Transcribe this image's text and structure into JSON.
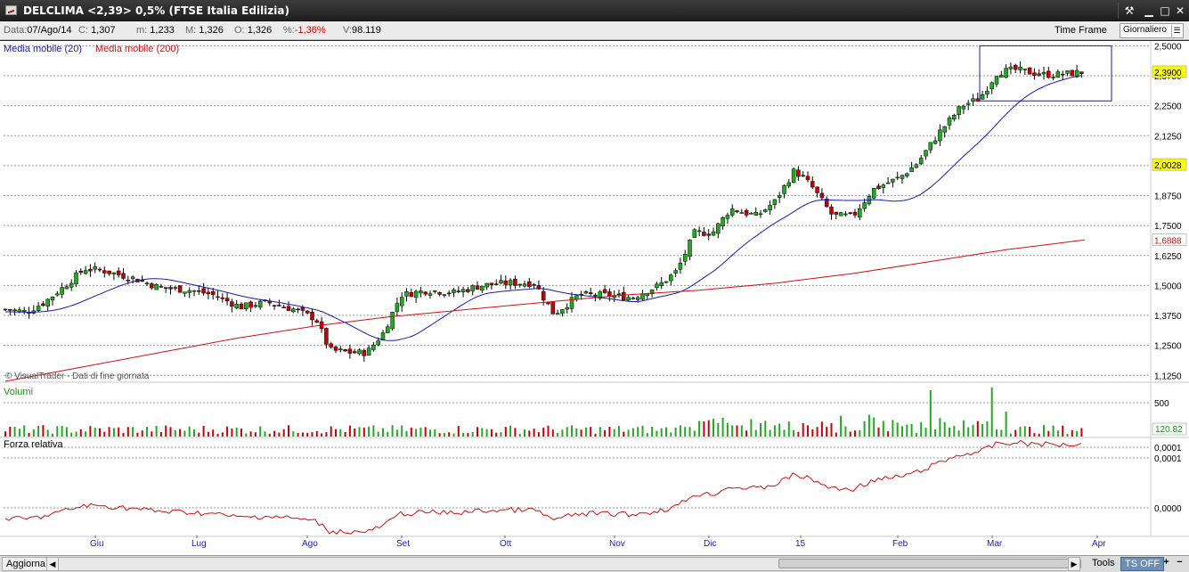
{
  "window": {
    "title": "DELCLIMA <2,39> 0,5%  (FTSE Italia Edilizia)",
    "buttons": {
      "tools": "⚒",
      "minimize": "▁",
      "maximize": "□",
      "close": "✕"
    }
  },
  "infobar": {
    "date_label": "Data:",
    "date_value": "07/Ago/14",
    "close_label": "C:",
    "close_value": "1,307",
    "min_label": "m:",
    "min_value": "1,233",
    "max_label": "M:",
    "max_value": "1,326",
    "open_label": "O:",
    "open_value": "1,326",
    "pct_label": "%:",
    "pct_value": "-1,36%",
    "vol_label": "V:",
    "vol_value": "98.119",
    "timeframe_label": "Time Frame",
    "timeframe_value": "Giornaliero"
  },
  "legend": {
    "ma20": "Media mobile (20)",
    "ma200": "Media mobile (200)",
    "copyright": "© VisualTrader - Dati di fine giornata",
    "volume": "Volumi",
    "rsi": "Forza relativa"
  },
  "colors": {
    "up": "#22aa22",
    "down": "#cc0000",
    "ma20": "#1a1aaa",
    "ma200": "#cc1111",
    "rsi": "#cc1111",
    "grid": "#9a9a9a",
    "last_price_bg": "#ffff00",
    "ma200_label": "#cc1111"
  },
  "bottombar": {
    "update": "Aggiorna",
    "tools": "Tools",
    "tsoff": "TS OFF",
    "plus": "+",
    "minus": "−"
  },
  "chart_data": [
    {
      "type": "candlestick",
      "title": "DELCLIMA <2,39> 0,5%  (FTSE Italia Edilizia)",
      "x_labels": [
        "Giu",
        "Lug",
        "Ago",
        "Set",
        "Ott",
        "Nov",
        "Dic",
        "15",
        "Feb",
        "Mar",
        "Apr"
      ],
      "y_ticks": [
        "2,5000",
        "2,3750",
        "2,2500",
        "2,1250",
        "2,0000",
        "1,8750",
        "1,7500",
        "1,6250",
        "1,5000",
        "1,3750",
        "1,2500",
        "1,1250"
      ],
      "ylim": [
        1.1,
        2.52
      ],
      "last_price": "2,3900",
      "ma20_last": "2,0028",
      "ma200_last": "1,6888",
      "ma20_series": [
        [
          1.45,
          1.45,
          1.45,
          1.46,
          1.48,
          1.49,
          1.51,
          1.52,
          1.53,
          1.52
        ],
        [
          1.51,
          1.51,
          1.49,
          1.48,
          1.47,
          1.46,
          1.45,
          1.44,
          1.43,
          1.42
        ],
        [
          1.42,
          1.41,
          1.4,
          1.37,
          1.35,
          1.32,
          1.29,
          1.27,
          1.27,
          1.29
        ],
        [
          1.32,
          1.36,
          1.4,
          1.44,
          1.46,
          1.48,
          1.5,
          1.51,
          1.52,
          1.52
        ],
        [
          1.51,
          1.5,
          1.48,
          1.47,
          1.46,
          1.45,
          1.45,
          1.46,
          1.48,
          1.52
        ],
        [
          1.58,
          1.64,
          1.7,
          1.75,
          1.79,
          1.82,
          1.84,
          1.87,
          1.88,
          1.88
        ],
        [
          1.89,
          1.91,
          1.94,
          1.98,
          2.04,
          2.1,
          2.17,
          2.26,
          2.33,
          2.37
        ],
        [
          2.39
        ]
      ],
      "ma200_series": [
        1.1,
        1.16,
        1.22,
        1.28,
        1.33,
        1.37,
        1.4,
        1.43,
        1.46,
        1.48,
        1.51,
        1.55,
        1.6,
        1.65,
        1.69
      ],
      "highlight_box": {
        "x_range": [
          "Mar",
          "Mar"
        ],
        "y_range": [
          2.27,
          2.5
        ]
      }
    },
    {
      "type": "bar",
      "title": "Volumi",
      "y_ticks": [
        "500"
      ],
      "last_value": "120.82"
    },
    {
      "type": "line",
      "title": "Forza relativa",
      "y_ticks": [
        "0,0001",
        "0,0001",
        "0,0000"
      ]
    }
  ]
}
